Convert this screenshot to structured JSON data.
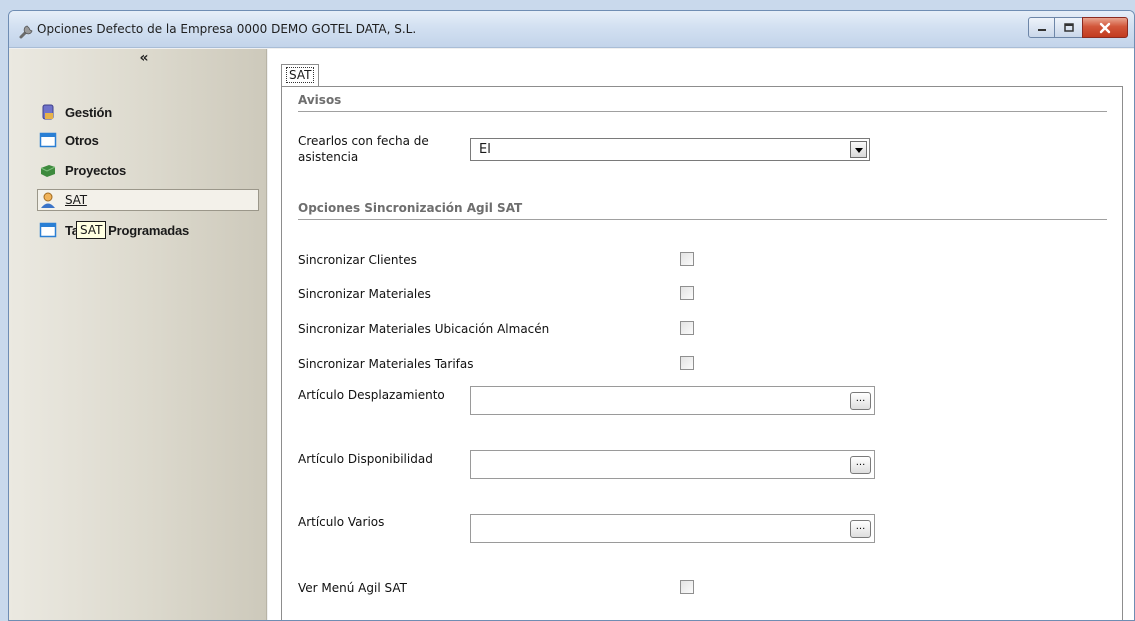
{
  "window": {
    "title": "Opciones Defecto de la Empresa 0000 DEMO GOTEL DATA, S.L.",
    "icons": {
      "title": "wrench-icon",
      "minimize": "minimize-icon",
      "maximize": "maximize-icon",
      "close": "close-icon"
    },
    "colors": {
      "close_button": "#c8452a",
      "titlebar": "#d2e0f1"
    }
  },
  "sidebar": {
    "collapse_label": "«",
    "items": [
      {
        "label": "Gestión",
        "icon": "database-icon",
        "selected": false
      },
      {
        "label": "Otros",
        "icon": "window-icon",
        "selected": false
      },
      {
        "label": "Proyectos",
        "icon": "cube-icon",
        "selected": false
      },
      {
        "label": "SAT",
        "icon": "user-icon",
        "selected": true
      },
      {
        "label": "Tareas Programadas",
        "icon": "window-icon",
        "selected": false
      }
    ],
    "tooltip": "SAT"
  },
  "main": {
    "tab_label": "SAT",
    "avisos": {
      "title": "Avisos",
      "crear_label": "Crearlos con fecha de asistencia",
      "crear_value": "El"
    },
    "sync": {
      "title": "Opciones Sincronización Agil SAT",
      "options": [
        {
          "label": "Sincronizar Clientes",
          "checked": false
        },
        {
          "label": "Sincronizar Materiales",
          "checked": false
        },
        {
          "label": "Sincronizar Materiales Ubicación Almacén",
          "checked": false
        },
        {
          "label": "Sincronizar Materiales Tarifas",
          "checked": false
        }
      ],
      "articulo_desplazamiento": {
        "label": "Artículo Desplazamiento",
        "value": "",
        "button": "..."
      },
      "articulo_disponibilidad": {
        "label": "Artículo Disponibilidad",
        "value": "",
        "button": "..."
      },
      "articulo_varios": {
        "label": "Artículo Varios",
        "value": "",
        "button": "..."
      },
      "ver_menu": {
        "label": "Ver Menú Agil SAT",
        "checked": false
      }
    }
  }
}
